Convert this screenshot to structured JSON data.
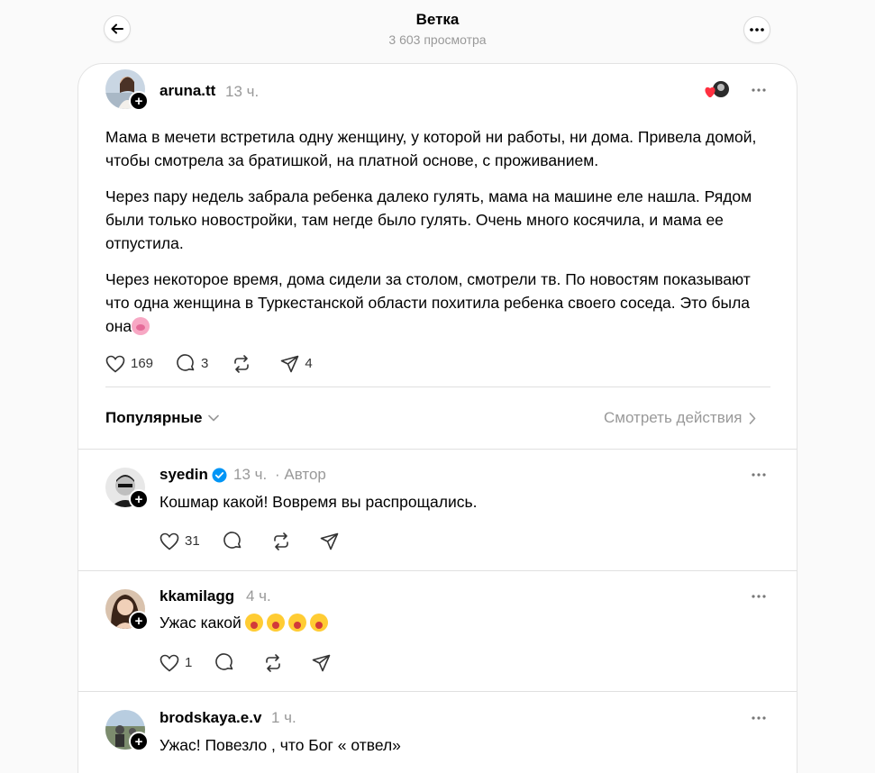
{
  "header": {
    "title": "Ветка",
    "views": "3 603 просмотра"
  },
  "post": {
    "username": "aruna.tt",
    "time": "13 ч.",
    "paragraphs": [
      "Мама в мечети встретила одну женщину, у которой ни работы, ни дома. Привела домой, чтобы смотрела за братишкой, на платной основе, с проживанием.",
      "Через пару недель забрала ребенка далеко гулять, мама на машине еле нашла. Рядом были только новостройки, там негде было гулять. Очень много косячила, и мама ее отпустила.",
      "Через некоторое время, дома сидели за столом, смотрели тв. По новостям показывают что одна женщина в Туркестанской области похитила ребенка своего соседа. Это была она"
    ],
    "likes": "169",
    "comments": "3",
    "shares": "4"
  },
  "sort": {
    "label": "Популярные",
    "view_actions": "Смотреть действия"
  },
  "replies": [
    {
      "username": "syedin",
      "time": "13 ч.",
      "author_tag": "· Автор",
      "text": "Кошмар какой! Вовремя вы распрощались.",
      "likes": "31"
    },
    {
      "username": "kkamilagg",
      "time": "4 ч.",
      "text": "Ужас какой",
      "likes": "1"
    },
    {
      "username": "brodskaya.e.v",
      "time": "1 ч.",
      "text": "Ужас! Повезло , что Бог « отвел»"
    }
  ],
  "colors": {
    "verified": "#0095f6",
    "like_heart": "#ff3040"
  }
}
